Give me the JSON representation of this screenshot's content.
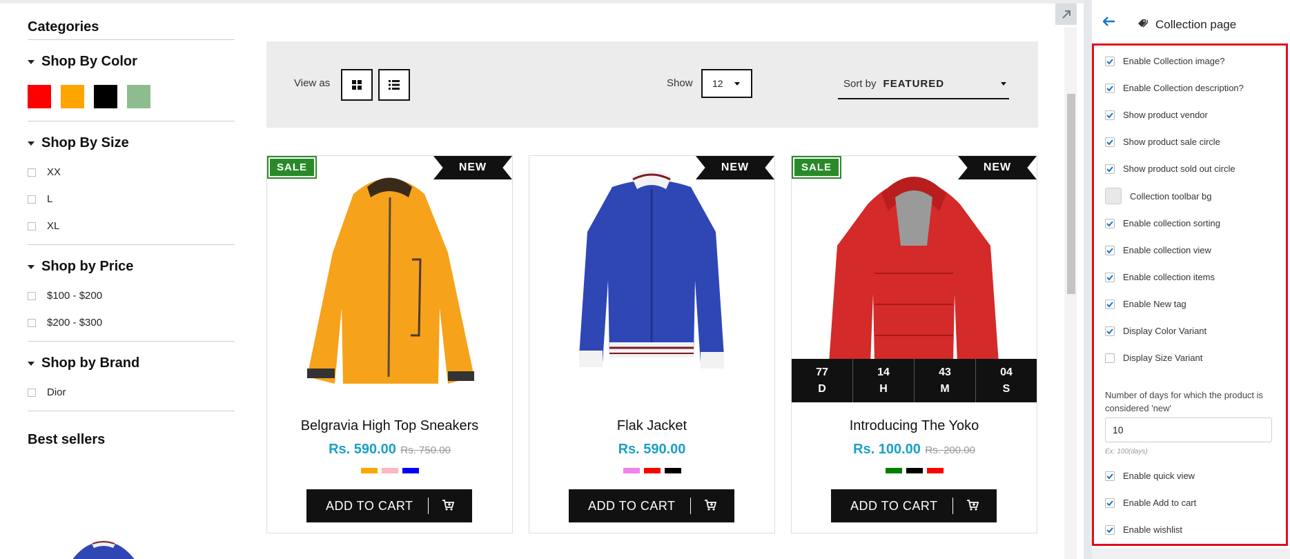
{
  "sidebar": {
    "categories_title": "Categories",
    "color": {
      "title": "Shop By Color",
      "swatches": [
        "#ff0000",
        "#ffa500",
        "#000000",
        "#8fbc8f"
      ]
    },
    "size": {
      "title": "Shop By Size",
      "options": [
        "XX",
        "L",
        "XL"
      ]
    },
    "price": {
      "title": "Shop by Price",
      "options": [
        "$100 - $200",
        "$200 - $300"
      ]
    },
    "brand": {
      "title": "Shop by Brand",
      "options": [
        "Dior"
      ]
    },
    "best_sellers_title": "Best sellers"
  },
  "toolbar": {
    "view_label": "View as",
    "show_label": "Show",
    "show_value": "12",
    "sort_label": "Sort by",
    "sort_value": "FEATURED"
  },
  "products": [
    {
      "name": "Belgravia High Top Sneakers",
      "price": "Rs. 590.00",
      "old_price": "Rs. 750.00",
      "badges": {
        "sale": "SALE",
        "new": "NEW"
      },
      "variants": [
        "#ffa500",
        "#ffb6c1",
        "#0000ff"
      ],
      "cta": "ADD TO CART"
    },
    {
      "name": "Flak Jacket",
      "price": "Rs. 590.00",
      "old_price": "",
      "badges": {
        "new": "NEW"
      },
      "variants": [
        "#ee82ee",
        "#ff0000",
        "#000000"
      ],
      "cta": "ADD TO CART"
    },
    {
      "name": "Introducing The Yoko",
      "price": "Rs. 100.00",
      "old_price": "Rs. 200.00",
      "badges": {
        "sale": "SALE",
        "new": "NEW"
      },
      "variants": [
        "#008000",
        "#000000",
        "#ff0000"
      ],
      "countdown": [
        {
          "value": "77",
          "unit": "D"
        },
        {
          "value": "14",
          "unit": "H"
        },
        {
          "value": "43",
          "unit": "M"
        },
        {
          "value": "04",
          "unit": "S"
        }
      ],
      "cta": "ADD TO CART"
    }
  ],
  "panel": {
    "title": "Collection page",
    "settings": [
      {
        "label": "Enable Collection image?",
        "checked": true
      },
      {
        "label": "Enable Collection description?",
        "checked": true
      },
      {
        "label": "Show product vendor",
        "checked": true
      },
      {
        "label": "Show product sale circle",
        "checked": true
      },
      {
        "label": "Show product sold out circle",
        "checked": true
      },
      {
        "label": "Collection toolbar bg",
        "type": "color"
      },
      {
        "label": "Enable collection sorting",
        "checked": true
      },
      {
        "label": "Enable collection view",
        "checked": true
      },
      {
        "label": "Enable collection items",
        "checked": true
      },
      {
        "label": "Enable New tag",
        "checked": true
      },
      {
        "label": "Display Color Variant",
        "checked": true
      },
      {
        "label": "Display Size Variant",
        "checked": false
      },
      {
        "label": "Enable quick view",
        "checked": true
      },
      {
        "label": "Enable Add to cart",
        "checked": true
      },
      {
        "label": "Enable wishlist",
        "checked": true
      }
    ],
    "days_label": "Number of days for which the product is considered 'new'",
    "days_value": "10",
    "days_hint": "Ex: 100(days)"
  },
  "colors": {
    "accent_price": "#1aa0c7",
    "sale_badge": "#2a8a2a",
    "highlight_border": "#e30b1c",
    "checkbox_blue": "#1a73c7"
  }
}
